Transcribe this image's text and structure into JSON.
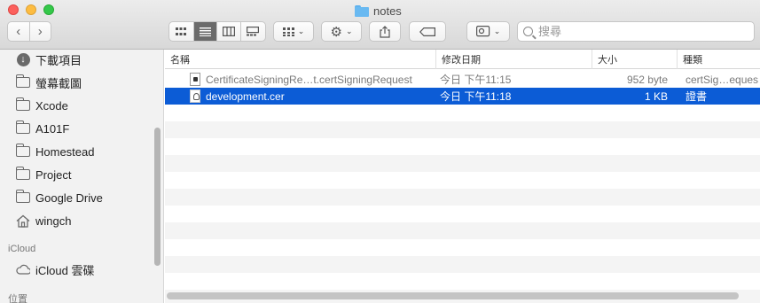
{
  "window": {
    "title": "notes"
  },
  "toolbar": {
    "back_icon": "chevron-left",
    "forward_icon": "chevron-right",
    "view_icons": [
      "icon-view",
      "list-view",
      "column-view",
      "gallery-view"
    ],
    "group_icon": "group-grid",
    "action_icon": "gear",
    "share_icon": "share",
    "tag_icon": "tag",
    "path_icon": "path-menu"
  },
  "search": {
    "placeholder": "搜尋"
  },
  "sidebar": {
    "items": [
      {
        "label": "下載項目",
        "icon": "download-icon"
      },
      {
        "label": "螢幕截圖",
        "icon": "folder-icon"
      },
      {
        "label": "Xcode",
        "icon": "folder-icon"
      },
      {
        "label": "A101F",
        "icon": "folder-icon"
      },
      {
        "label": "Homestead",
        "icon": "folder-icon"
      },
      {
        "label": "Project",
        "icon": "folder-icon"
      },
      {
        "label": "Google Drive",
        "icon": "folder-icon"
      },
      {
        "label": "wingch",
        "icon": "home-icon"
      }
    ],
    "icloud_header": "iCloud",
    "icloud_items": [
      {
        "label": "iCloud 雲碟",
        "icon": "cloud-icon"
      }
    ],
    "locations_header": "位置"
  },
  "columns": {
    "name": "名稱",
    "modified": "修改日期",
    "size": "大小",
    "kind": "種類"
  },
  "files": [
    {
      "name": "CertificateSigningRe…t.certSigningRequest",
      "modified": "今日 下午11:15",
      "size": "952 byte",
      "kind": "certSig…eques"
    },
    {
      "name": "development.cer",
      "modified": "今日 下午11:18",
      "size": "1 KB",
      "kind": "證書"
    }
  ],
  "colors": {
    "selection": "#0c5cd6",
    "folder": "#69b9f1"
  }
}
